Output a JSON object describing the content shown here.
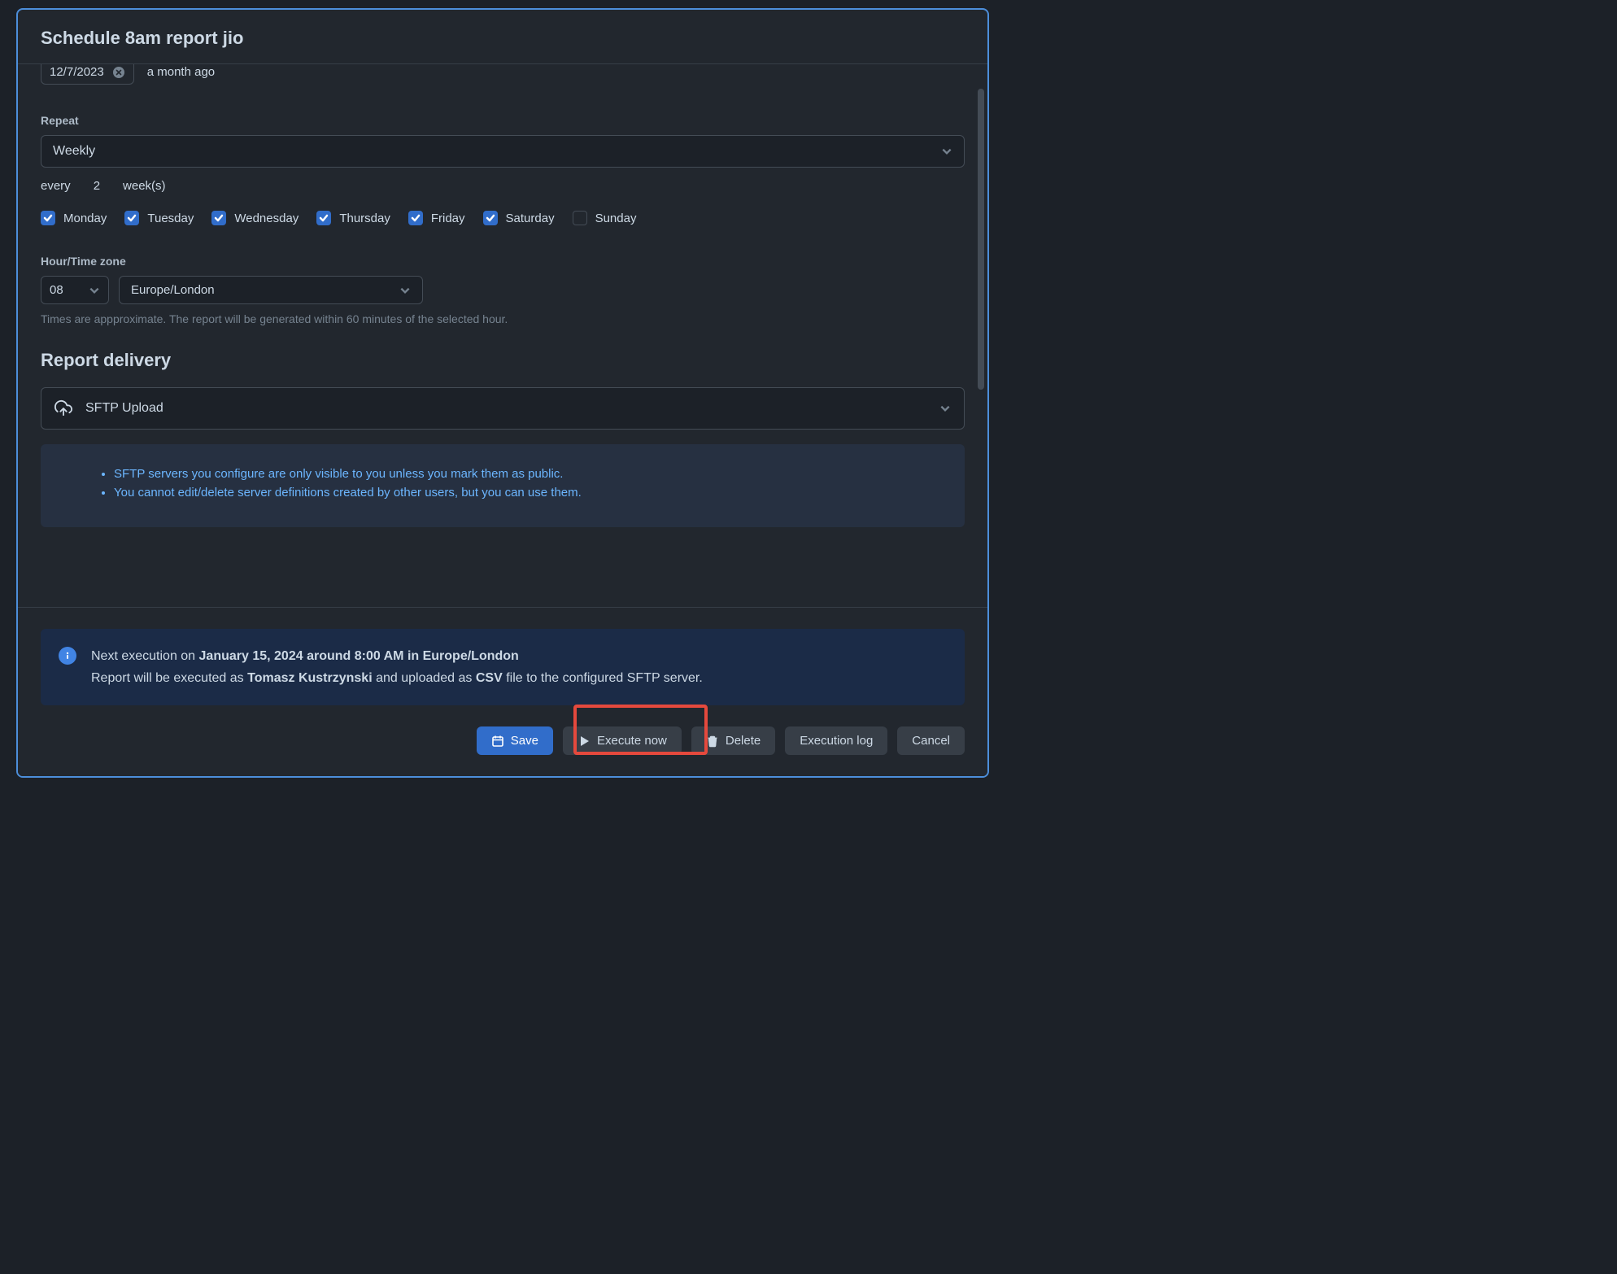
{
  "modal": {
    "title": "Schedule 8am report jio"
  },
  "start": {
    "date": "12/7/2023",
    "relative": "a month ago"
  },
  "repeat": {
    "label": "Repeat",
    "value": "Weekly",
    "every_prefix": "every",
    "every_value": "2",
    "every_unit": "week(s)"
  },
  "days": [
    {
      "label": "Monday",
      "checked": true
    },
    {
      "label": "Tuesday",
      "checked": true
    },
    {
      "label": "Wednesday",
      "checked": true
    },
    {
      "label": "Thursday",
      "checked": true
    },
    {
      "label": "Friday",
      "checked": true
    },
    {
      "label": "Saturday",
      "checked": true
    },
    {
      "label": "Sunday",
      "checked": false
    }
  ],
  "hour": {
    "label": "Hour/Time zone",
    "hour_value": "08",
    "tz_value": "Europe/London",
    "help": "Times are appproximate. The report will be generated within 60 minutes of the selected hour."
  },
  "delivery": {
    "section_title": "Report delivery",
    "method": "SFTP Upload",
    "notes": [
      "SFTP servers you configure are only visible to you unless you mark them as public.",
      "You cannot edit/delete server definitions created by other users, but you can use them."
    ]
  },
  "footer": {
    "next_exec_prefix": "Next execution on ",
    "next_exec_bold": "January 15, 2024 around 8:00 AM in Europe/London",
    "exec_line_1": "Report will be executed as ",
    "exec_user": "Tomasz Kustrzynski",
    "exec_line_2": " and uploaded as ",
    "exec_format": "CSV",
    "exec_line_3": " file to the configured SFTP server.",
    "buttons": {
      "save": "Save",
      "execute": "Execute now",
      "delete": "Delete",
      "log": "Execution log",
      "cancel": "Cancel"
    }
  }
}
